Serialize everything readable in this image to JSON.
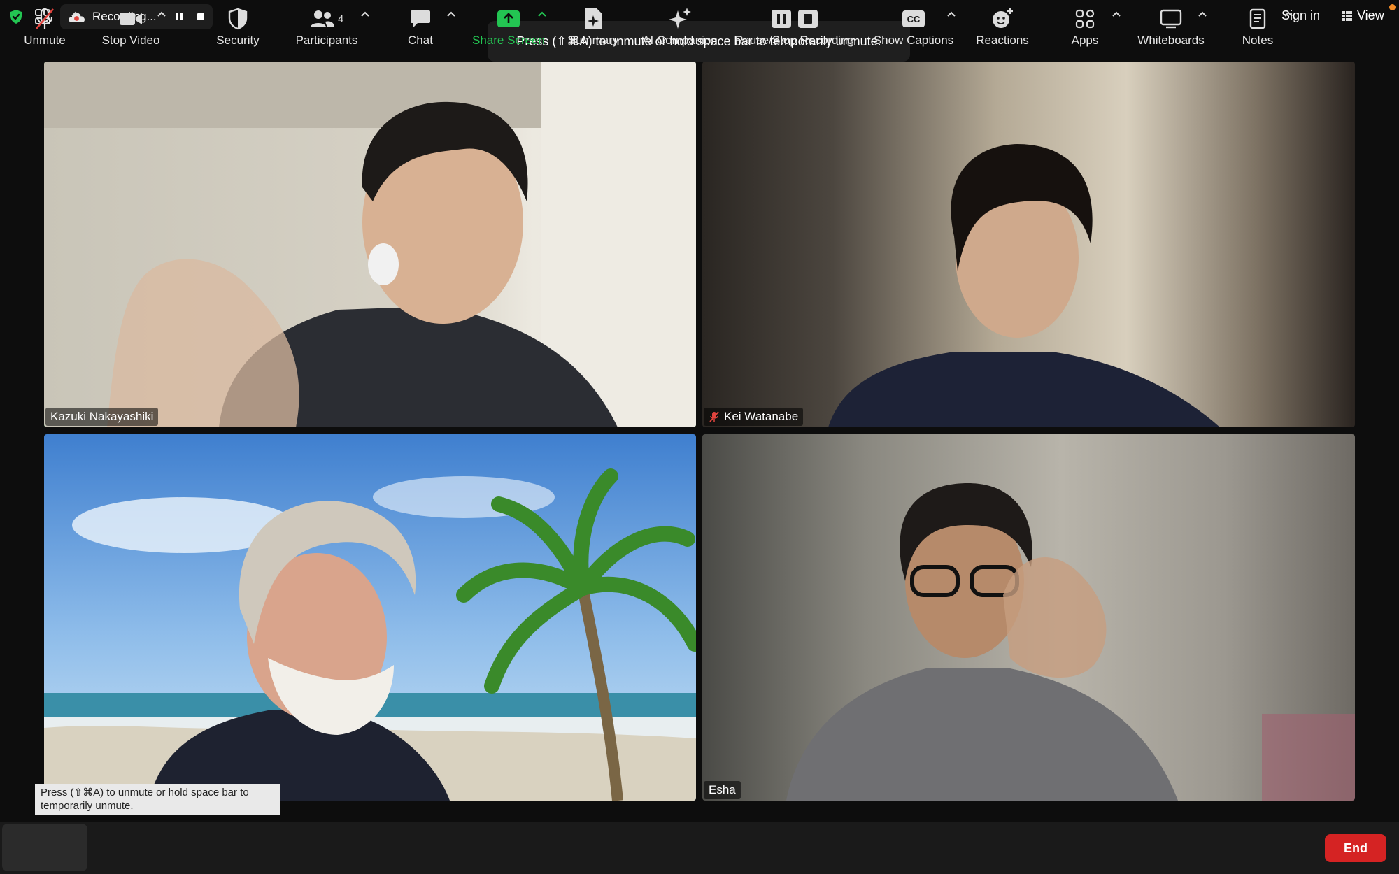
{
  "top_bar": {
    "recording_label": "Recording...",
    "sign_in_label": "Sign in",
    "view_label": "View"
  },
  "unmute_toast_top": "Press (⇧⌘A) to unmute or hold space bar to temporarily unmute.",
  "unmute_toast_bottom_line1": "Press (⇧⌘A) to unmute or hold space bar to",
  "unmute_toast_bottom_line2": "temporarily unmute.",
  "participants": [
    {
      "name": "Kazuki Nakayashiki",
      "muted": false,
      "active_speaker": true
    },
    {
      "name": "Kei Watanabe",
      "muted": true,
      "active_speaker": false
    },
    {
      "name": "",
      "muted": false,
      "active_speaker": false
    },
    {
      "name": "Esha",
      "muted": false,
      "active_speaker": false
    }
  ],
  "toolbar": {
    "unmute": "Unmute",
    "stop_video": "Stop Video",
    "security": "Security",
    "participants": "Participants",
    "participants_count": "4",
    "chat": "Chat",
    "share_screen": "Share Screen",
    "summary": "Summary",
    "ai_companion": "AI Companion",
    "pause_stop_recording": "Pause/Stop Recording",
    "show_captions": "Show Captions",
    "captions_icon_text": "CC",
    "reactions": "Reactions",
    "apps": "Apps",
    "whiteboards": "Whiteboards",
    "notes": "Notes",
    "end": "End"
  },
  "colors": {
    "active_border": "#23d95b",
    "share_green": "#23c552",
    "end_red": "#d52323",
    "mute_red": "#e0443e"
  }
}
